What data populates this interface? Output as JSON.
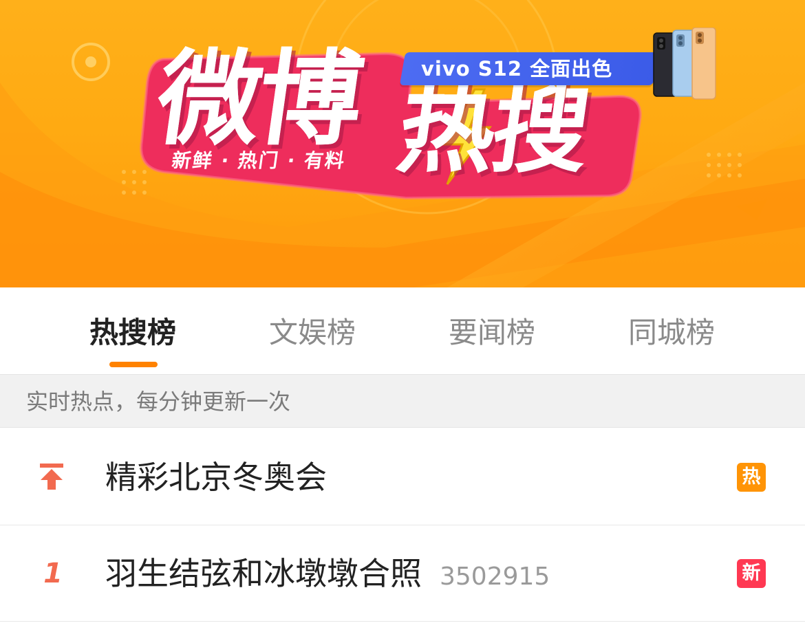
{
  "banner": {
    "logo_weibo": "微博",
    "logo_resou": "热搜",
    "slogan": "新鲜 · 热门 · 有料",
    "sponsor_text": "vivo S12 全面出色",
    "colors": {
      "background": "#ffaa12",
      "logo_board": "#ee2d5c",
      "badge": "#4566ee"
    }
  },
  "tabs": [
    {
      "label": "热搜榜",
      "active": true
    },
    {
      "label": "文娱榜",
      "active": false
    },
    {
      "label": "要闻榜",
      "active": false
    },
    {
      "label": "同城榜",
      "active": false
    }
  ],
  "subheader": {
    "text": "实时热点，每分钟更新一次"
  },
  "list": [
    {
      "rank_icon": "pin-top-icon",
      "title": "精彩北京冬奥会",
      "count": "",
      "badge": "热",
      "badge_color": "#ff9406"
    },
    {
      "rank": "1",
      "title": "羽生结弦和冰墩墩合照",
      "count": "3502915",
      "badge": "新",
      "badge_color": "#ff3852"
    }
  ],
  "colors": {
    "accent": "#ff8200",
    "rank": "#f26a4f"
  }
}
